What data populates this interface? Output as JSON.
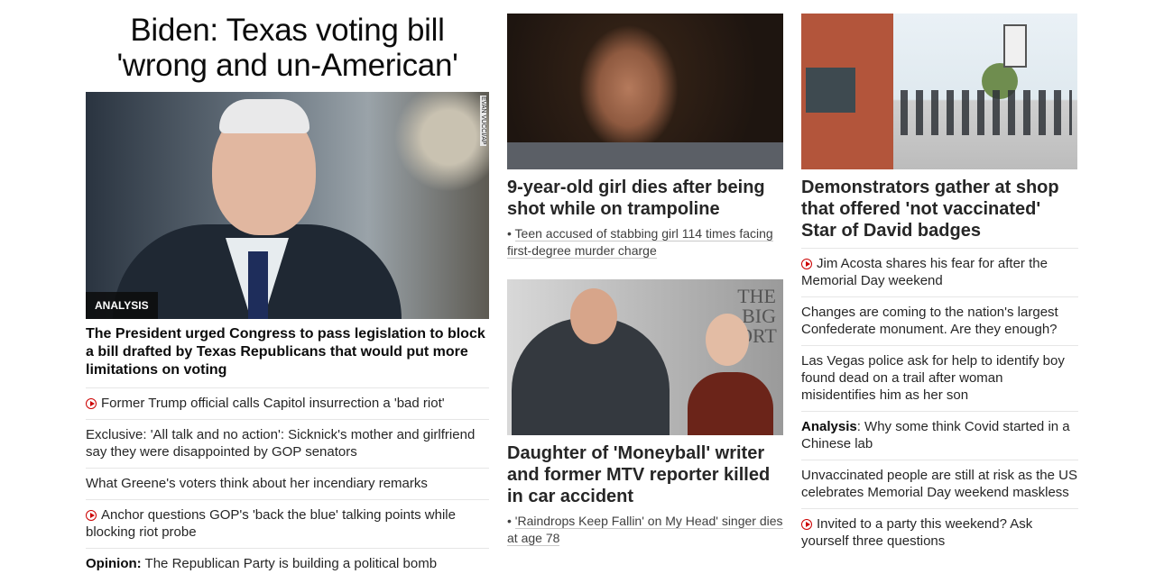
{
  "left": {
    "headline": "Biden: Texas voting bill 'wrong and un-American'",
    "image_credit": "EVAN VUCCI/AP",
    "badge": "ANALYSIS",
    "lead": "The President urged Congress to pass legislation to block a bill drafted by Texas Republicans that would put more limitations on voting",
    "items": [
      {
        "prefix": "",
        "text": "Former Trump official calls Capitol insurrection a 'bad riot'",
        "video": true
      },
      {
        "prefix": "",
        "text": "Exclusive: 'All talk and no action': Sicknick's mother and girlfriend say they were disappointed by GOP senators",
        "video": false
      },
      {
        "prefix": "",
        "text": "What Greene's voters think about her incendiary remarks",
        "video": false
      },
      {
        "prefix": "",
        "text": "Anchor questions GOP's 'back the blue' talking points while blocking riot probe",
        "video": true
      },
      {
        "prefix": "Opinion:",
        "text": " The Republican Party is building a political bomb",
        "video": false
      }
    ]
  },
  "middle": {
    "card1": {
      "title": "9-year-old girl dies after being shot while on trampoline",
      "sub": "Teen accused of stabbing girl 114 times facing first-degree murder charge"
    },
    "card2": {
      "image_text": "THE BIG SHORT",
      "title": "Daughter of 'Moneyball' writer and former MTV reporter killed in car accident",
      "sub": "'Raindrops Keep Fallin' on My Head' singer dies at age 78"
    }
  },
  "right": {
    "title": "Demonstrators gather at shop that offered 'not vaccinated' Star of David badges",
    "items": [
      {
        "prefix": "",
        "text": "Jim Acosta shares his fear for after the Memorial Day weekend",
        "video": true
      },
      {
        "prefix": "",
        "text": "Changes are coming to the nation's largest Confederate monument. Are they enough?",
        "video": false
      },
      {
        "prefix": "",
        "text": "Las Vegas police ask for help to identify boy found dead on a trail after woman misidentifies him as her son",
        "video": false
      },
      {
        "prefix": "Analysis",
        "text": ": Why some think Covid started in a Chinese lab",
        "video": false
      },
      {
        "prefix": "",
        "text": "Unvaccinated people are still at risk as the US celebrates Memorial Day weekend maskless",
        "video": false
      },
      {
        "prefix": "",
        "text": "Invited to a party this weekend? Ask yourself three questions",
        "video": true
      }
    ]
  },
  "colors": {
    "accent_red": "#cc0000",
    "text": "#0c0c0c",
    "divider": "#e6e6e6"
  }
}
